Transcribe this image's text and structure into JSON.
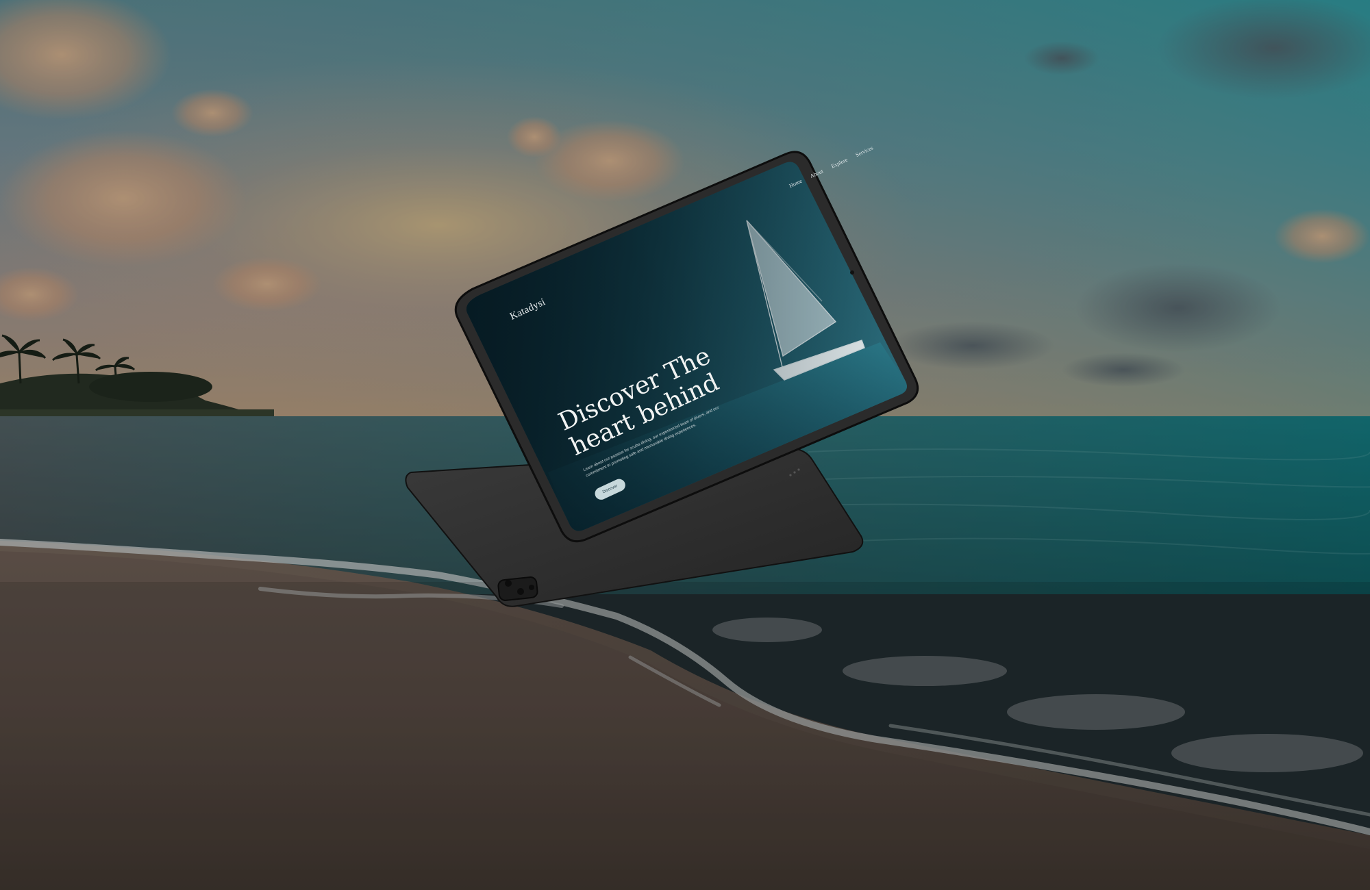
{
  "screen": {
    "brand": "Katadysi",
    "nav": [
      "Home",
      "About",
      "Explore",
      "Services"
    ],
    "hero_title": "Discover The heart behind",
    "hero_text": "Learn about our passion for scuba diving, our experienced team of divers, and our commitment to promoting safe and memorable diving experiences.",
    "cta_label": "Discover"
  },
  "colors": {
    "sky_top": "#3aa6ad",
    "sky_bottom": "#c9a98a",
    "sea": "#1f8d92",
    "sand": "#8a7463",
    "tablet_body": "#2a2a2a",
    "screen_dark": "#0e2a33"
  }
}
